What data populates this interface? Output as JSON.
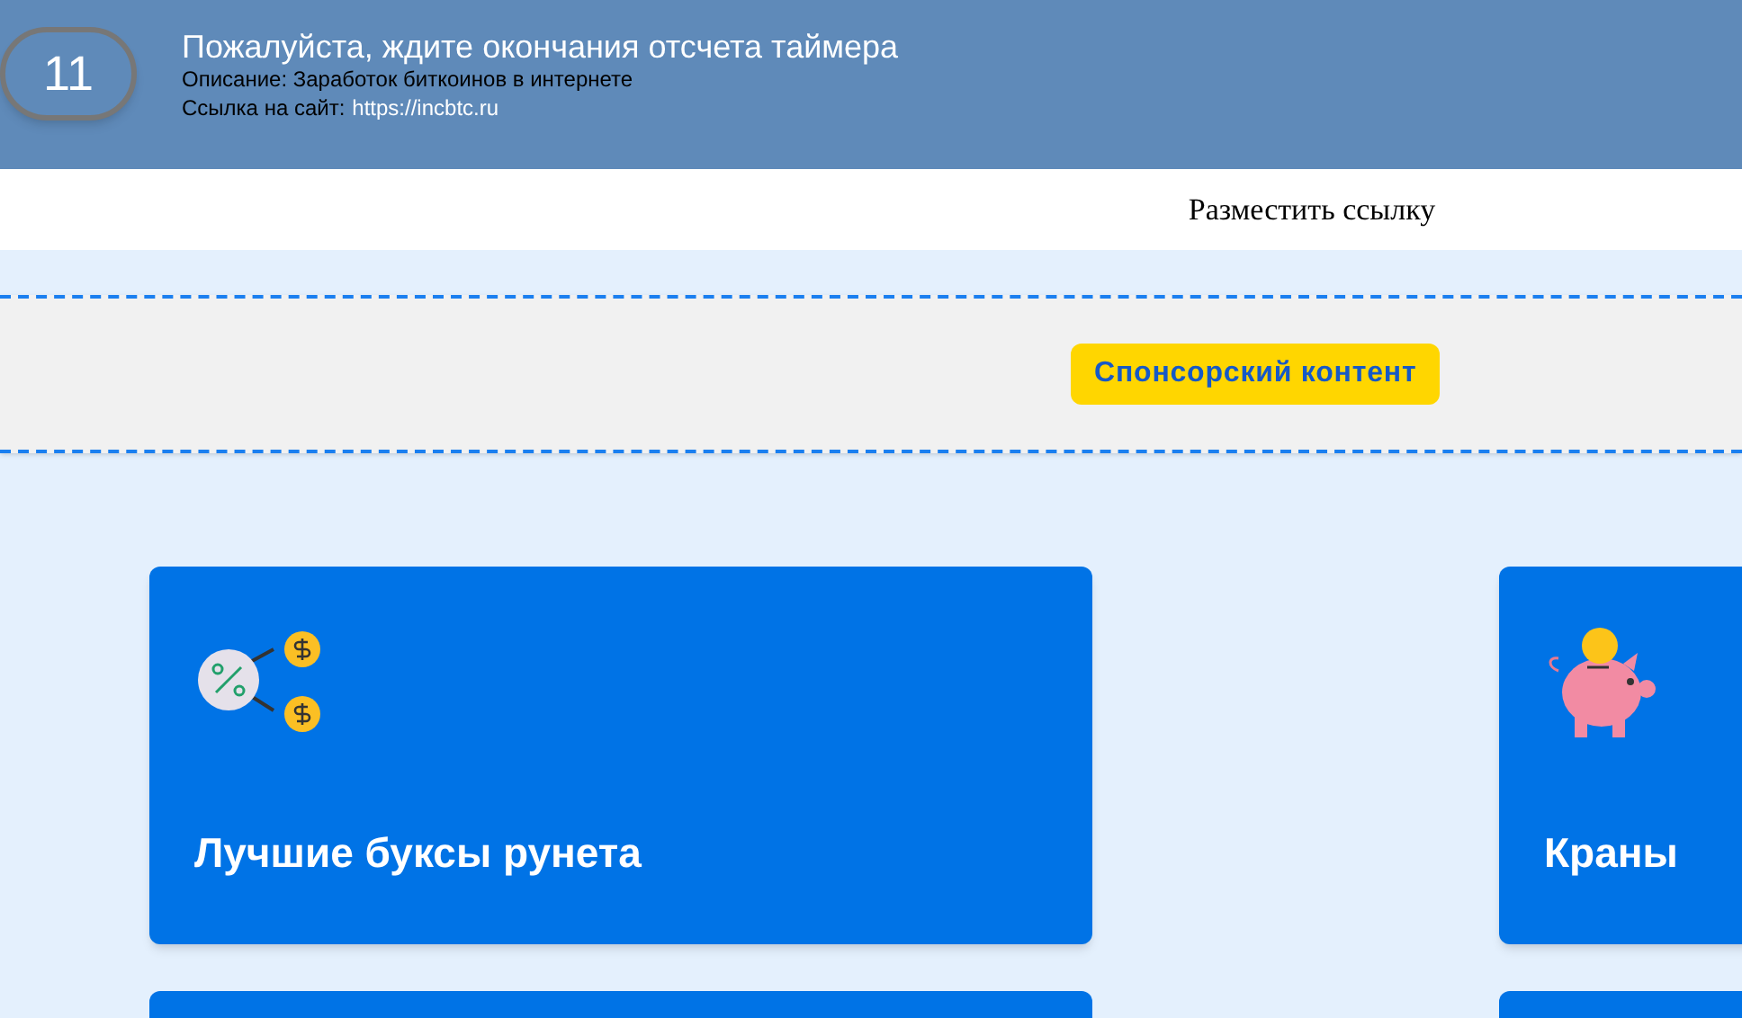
{
  "header": {
    "timer": "11",
    "title": "Пожалуйста, ждите окончания отсчета таймера",
    "description": "Описание: Заработок биткоинов в интернете",
    "link_label": "Ссылка на сайт:",
    "link_url": "https://incbtc.ru"
  },
  "nav": {
    "link": "Разместить ссылку"
  },
  "sponsor": {
    "badge": "Спонсорский контент"
  },
  "cards": [
    {
      "kind": "referral",
      "title": "Лучшие буксы рунета"
    },
    {
      "kind": "piggy",
      "title": "Краны"
    }
  ]
}
